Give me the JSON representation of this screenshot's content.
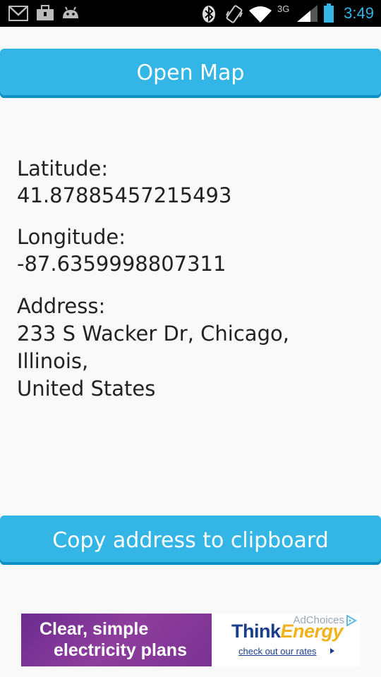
{
  "status_bar": {
    "time": "3:49",
    "network": "3G",
    "icons": [
      "gmail-icon",
      "briefcase-icon",
      "android-icon",
      "bluetooth-icon",
      "vibrate-icon",
      "wifi-icon",
      "signal-icon",
      "battery-icon"
    ],
    "accent_color": "#33b5e5"
  },
  "open_map_button": {
    "label": "Open Map"
  },
  "location": {
    "latitude_label": "Latitude:",
    "latitude_value": "41.87885457215493",
    "longitude_label": "Longitude:",
    "longitude_value": "-87.6359998807311",
    "address_label": "Address:",
    "address_lines": [
      "233 S Wacker Dr, Chicago,",
      "Illinois,",
      "United States"
    ]
  },
  "copy_button": {
    "label": "Copy address to clipboard"
  },
  "ad": {
    "left_line1": "Clear, simple",
    "left_line2": "electricity plans",
    "brand_part1": "Think",
    "brand_part2": "Energy",
    "adchoices": "AdChoices",
    "cta": "check out our rates"
  },
  "colors": {
    "button": "#33b5e5",
    "button_shadow": "#0e8fc3",
    "background": "#f9f9f9",
    "ad_purple": "#7a3293",
    "ad_brand_blue": "#1b3e8c",
    "ad_brand_yellow": "#f2b21b"
  }
}
